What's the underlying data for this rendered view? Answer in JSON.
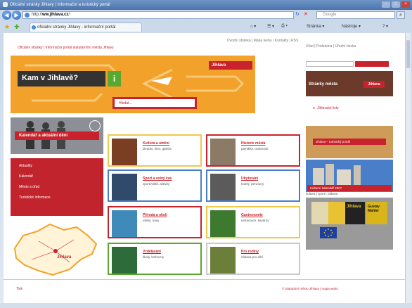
{
  "window": {
    "title": "Oficiální stránky Jihlavy | Informační a turistický portál",
    "controls": [
      "–",
      "□",
      "×"
    ]
  },
  "addressbar": {
    "url_prefix": "http://",
    "url_domain": "ww.jihlava.cz",
    "url_rest": "/",
    "search_placeholder": "Google"
  },
  "tabs": [
    {
      "label": "oficiální stránky Jihlavy - informační portál"
    }
  ],
  "commandbar": [
    "Stránka ▾",
    "Nástroje ▾"
  ],
  "site": {
    "toplinks": "Úvodní stránka | Mapa webu | Kontakty | RSS",
    "breadcrumb": "Oficiální stránky | Informační portál statutárního města Jihlavy",
    "toplinks2": "Úřad | Podatelna | Úřední deska",
    "banner_title": "Kam v Jihlavě?",
    "banner_icon": "i",
    "banner_logo": "Jihlava",
    "search_value": "Hledat..."
  },
  "left": {
    "video_label": "Kalendář a aktuální dění",
    "menu": [
      "Aktuality",
      "Kalendář",
      "Město a úřad",
      "Turistické informace"
    ],
    "map_label": "Jihlava"
  },
  "tiles": [
    {
      "title": "Kultura a umění",
      "sub": "divadlo, kino, galerie"
    },
    {
      "title": "Historie města",
      "sub": "památky, osobnosti"
    },
    {
      "title": "Sport a volný čas",
      "sub": "sportoviště, aktivity"
    },
    {
      "title": "Ubytování",
      "sub": "hotely, penziony"
    },
    {
      "title": "Příroda a okolí",
      "sub": "výlety, trasy"
    },
    {
      "title": "Gastronomie",
      "sub": "restaurace, kavárny"
    },
    {
      "title": "Vzdělávání",
      "sub": "školy, knihovny"
    },
    {
      "title": "Pro rodiny",
      "sub": "zábava pro děti"
    }
  ],
  "right": {
    "promo_label": "Stránky města",
    "promo_badge": "Jihlava",
    "link": "Jihlavské listy",
    "panel1_label": "Jihlava – turistický portál",
    "panel2_label": "Kulturní kalendář 2007",
    "small_links": "kultura | sport | zábava",
    "poster1": "Jihlava",
    "poster2": "Gustav Mahler"
  },
  "footer": {
    "left": "Tisk",
    "right": "© Statutární město Jihlava | mapa webu"
  }
}
